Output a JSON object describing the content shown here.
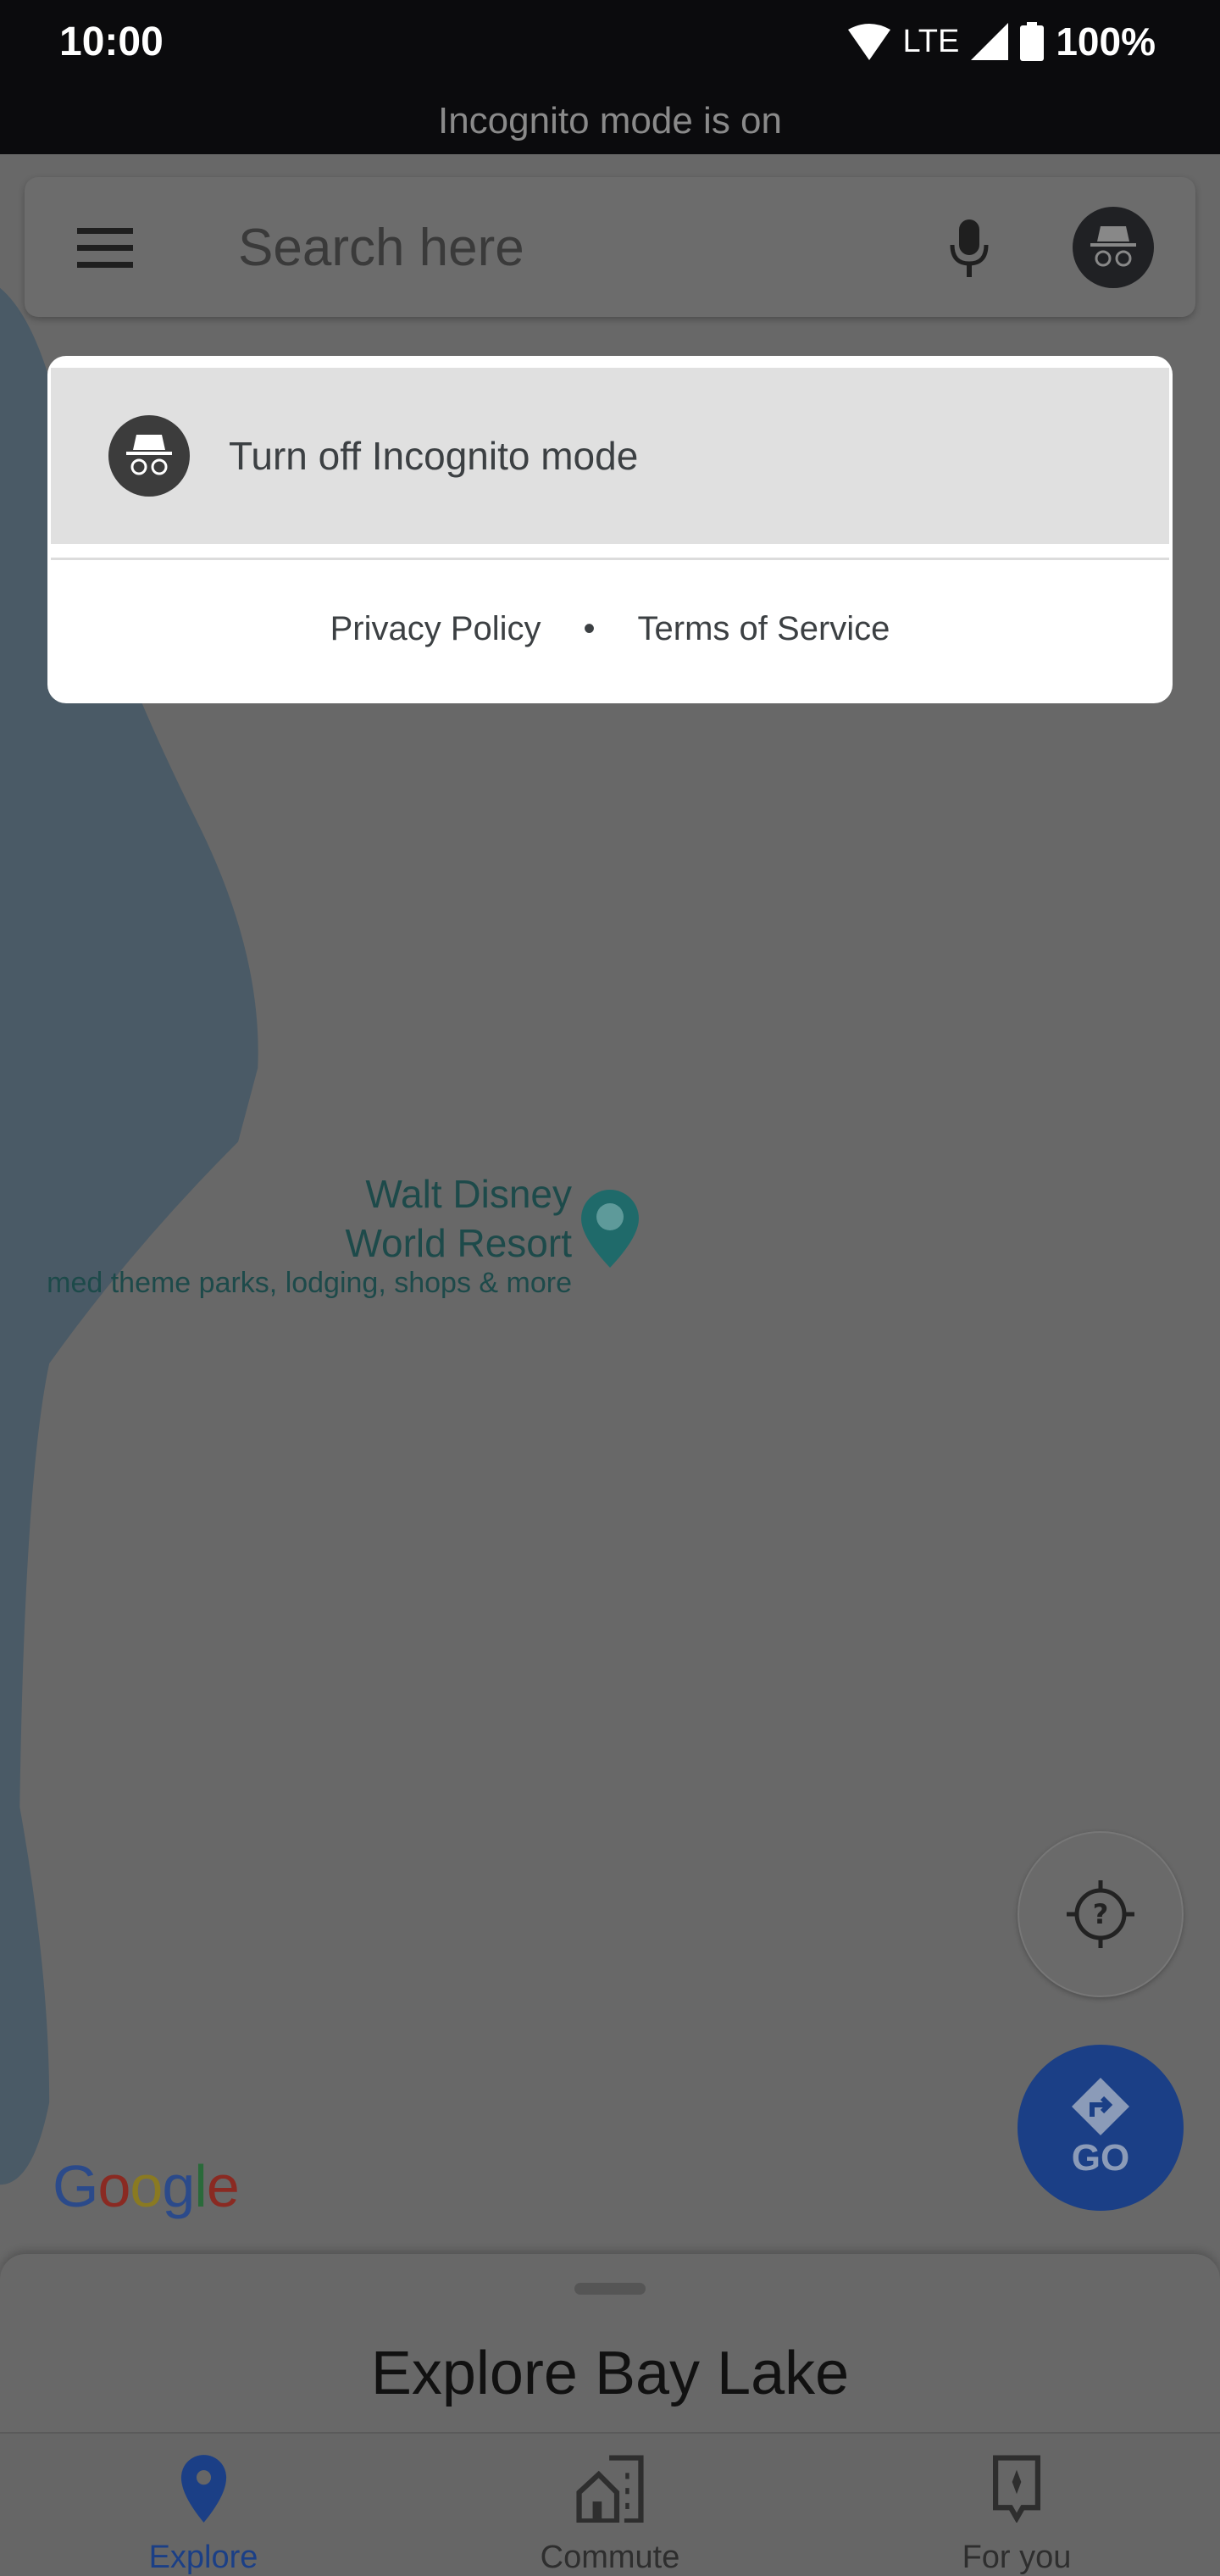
{
  "status_bar": {
    "time": "10:00",
    "network": "LTE",
    "battery": "100%",
    "banner": "Incognito mode is on"
  },
  "search": {
    "placeholder": "Search here",
    "icons": [
      "menu-icon",
      "microphone-icon",
      "incognito-avatar-icon"
    ]
  },
  "dialog": {
    "turn_off_label": "Turn off Incognito mode",
    "privacy_policy": "Privacy Policy",
    "separator": "•",
    "terms": "Terms of Service"
  },
  "map": {
    "poi_name": "Walt Disney World Resort",
    "poi_description": "med theme parks, lodging, shops & more",
    "logo": "Google",
    "go_label": "GO"
  },
  "sheet": {
    "title": "Explore Bay Lake"
  },
  "nav": {
    "items": [
      {
        "label": "Explore",
        "active": true
      },
      {
        "label": "Commute"
      },
      {
        "label": "For you"
      }
    ]
  },
  "colors": {
    "accent": "#1b3f86",
    "water": "#4a5a66",
    "scrim_map": "#686868"
  }
}
